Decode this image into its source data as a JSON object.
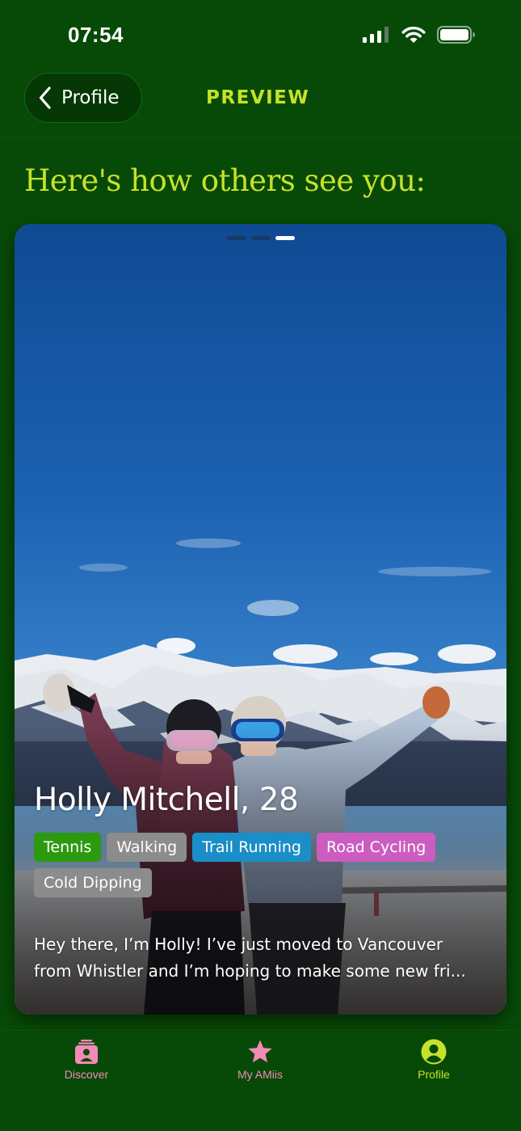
{
  "status_bar": {
    "time": "07:54"
  },
  "header": {
    "back_label": "Profile",
    "title": "PREVIEW"
  },
  "intro": {
    "heading": "Here's how others see you:"
  },
  "profile": {
    "name_age": "Holly Mitchell, 28",
    "photo_count": 3,
    "active_photo": 3,
    "tags": [
      {
        "label": "Tennis",
        "color": "#2b9a0f"
      },
      {
        "label": "Walking",
        "color": "#8c8c8c"
      },
      {
        "label": "Trail Running",
        "color": "#1a8ec7"
      },
      {
        "label": "Road Cycling",
        "color": "#cc5cc0"
      },
      {
        "label": "Cold Dipping",
        "color": "#8c8c8c"
      }
    ],
    "bio_line1": "Hey there, I’m Holly! I’ve just moved to Vancouver",
    "bio_line2": "from Whistler and I’m hoping to make some new fri..."
  },
  "tab_bar": {
    "items": [
      {
        "label": "Discover",
        "icon": "contact-card-icon",
        "color": "#f28bb8"
      },
      {
        "label": "My AMiis",
        "icon": "star-icon",
        "color": "#f28bb8"
      },
      {
        "label": "Profile",
        "icon": "person-circle-icon",
        "color": "#c7e12b"
      }
    ]
  },
  "colors": {
    "background": "#074a07",
    "accent": "#c7e12b",
    "pink": "#f28bb8"
  }
}
